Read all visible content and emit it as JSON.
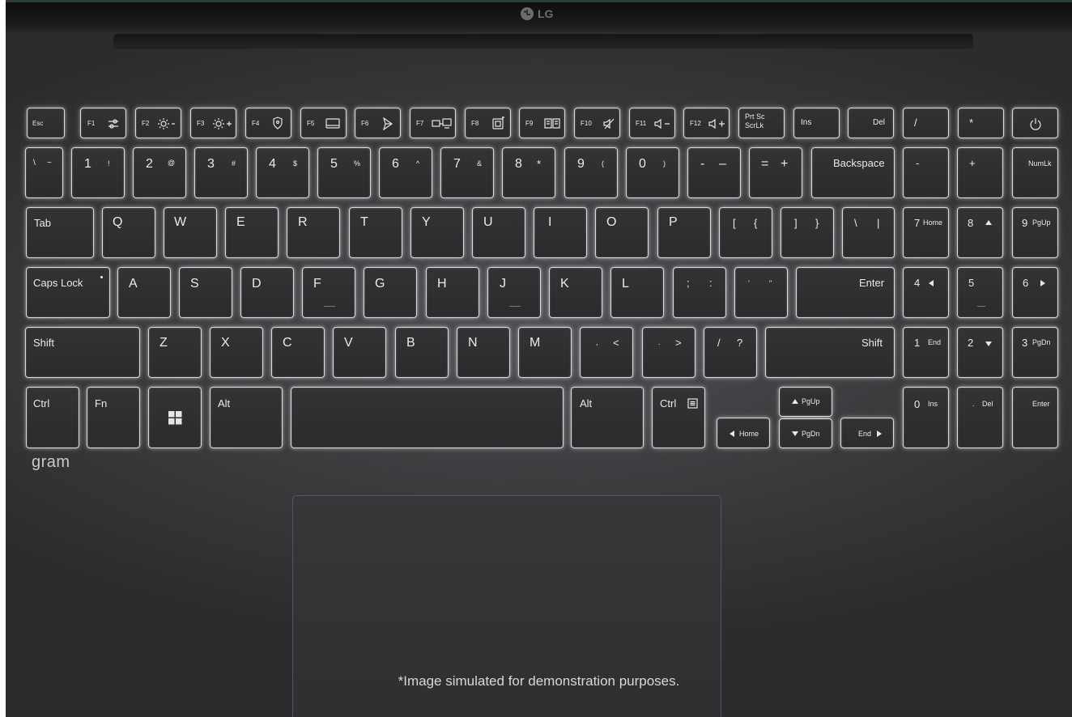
{
  "brand": {
    "logo": "LG",
    "series": "gram"
  },
  "disclaimer": "*Image simulated for demonstration purposes.",
  "keys": {
    "esc": "Esc",
    "f1": "F1",
    "f2": "F2",
    "f3": "F3",
    "f4": "F4",
    "f5": "F5",
    "f6": "F6",
    "f7": "F7",
    "f8": "F8",
    "f9": "F9",
    "f10": "F10",
    "f11": "F11",
    "f12": "F12",
    "prtsc": "Prt Sc",
    "scrlk": "ScrLk",
    "ins": "Ins",
    "del": "Del",
    "np_slash": "/",
    "np_star": "*",
    "tilde_a": "\\",
    "tilde_b": "~",
    "d1": "1",
    "d1s": "!",
    "d2": "2",
    "d2s": "@",
    "d3": "3",
    "d3s": "#",
    "d4": "4",
    "d4s": "$",
    "d5": "5",
    "d5s": "%",
    "d6": "6",
    "d6s": "^",
    "d7": "7",
    "d7s": "&",
    "d8": "8",
    "d8s": "*",
    "d9": "9",
    "d9s": "(",
    "d0": "0",
    "d0s": ")",
    "minus_a": "-",
    "minus_b": "–",
    "eq_a": "=",
    "eq_b": "+",
    "backspace": "Backspace",
    "np_minus": "-",
    "np_plus": "+",
    "numlk": "NumLk",
    "tab": "Tab",
    "q": "Q",
    "w": "W",
    "e": "E",
    "r": "R",
    "t": "T",
    "y": "Y",
    "u": "U",
    "i": "I",
    "o": "O",
    "p": "P",
    "lb_a": "[",
    "lb_b": "{",
    "rb_a": "]",
    "rb_b": "}",
    "bs_a": "\\",
    "bs_b": "|",
    "np7": "7",
    "np7s": "Home",
    "np8": "8",
    "np9": "9",
    "np9s": "PgUp",
    "caps": "Caps Lock",
    "a": "A",
    "s": "S",
    "d": "D",
    "f": "F",
    "g": "G",
    "h": "H",
    "j": "J",
    "k": "K",
    "l": "L",
    "semi_a": ";",
    "semi_b": ":",
    "quote_a": "'",
    "quote_b": "\"",
    "enter": "Enter",
    "np4": "4",
    "np5": "5",
    "np6": "6",
    "shift": "Shift",
    "z": "Z",
    "x": "X",
    "c": "C",
    "v": "V",
    "b": "B",
    "n": "N",
    "m": "M",
    "comma_a": ",",
    "comma_b": "<",
    "period_a": ".",
    "period_b": ">",
    "slash_a": "/",
    "slash_b": "?",
    "shift_r": "Shift",
    "np1": "1",
    "np1s": "End",
    "np2": "2",
    "np3": "3",
    "np3s": "PgDn",
    "ctrl": "Ctrl",
    "fn": "Fn",
    "alt": "Alt",
    "alt_r": "Alt",
    "ctrl_r": "Ctrl",
    "pgup": "PgUp",
    "home": "Home",
    "pgdn": "PgDn",
    "end": "End",
    "np0": "0",
    "np0s": "Ins",
    "npdot": ".",
    "npdel": "Del",
    "npenter": "Enter"
  },
  "icons": {
    "f1": "settings-sliders-icon",
    "f2": "brightness-down-icon",
    "f3": "brightness-up-icon",
    "f4": "shield-icon",
    "f5": "touchpad-icon",
    "f6": "airplane-icon",
    "f7": "display-switch-icon",
    "f8": "screen-capture-icon",
    "f9": "reader-mode-icon",
    "f10": "mute-icon",
    "f11": "volume-down-icon",
    "f12": "volume-up-icon",
    "power": "power-icon",
    "windows": "windows-logo-icon",
    "menu": "context-menu-icon"
  }
}
